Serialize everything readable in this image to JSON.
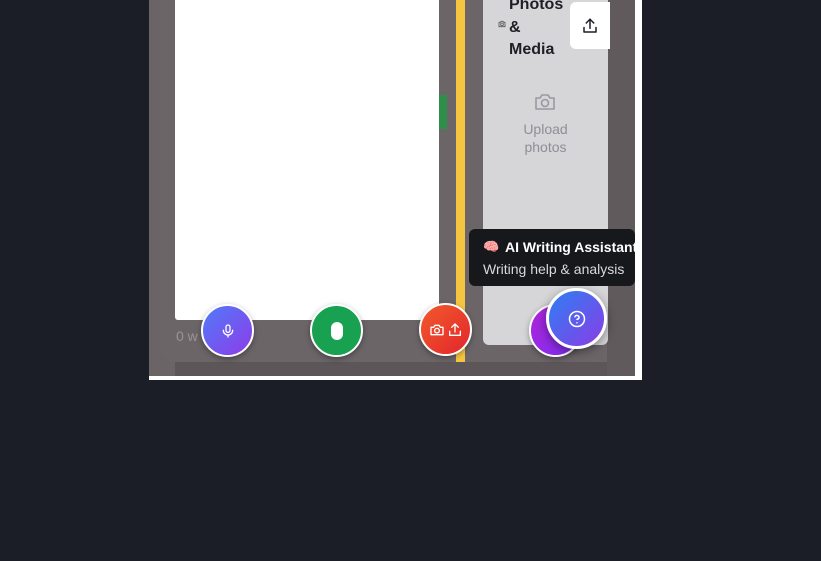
{
  "editor": {
    "word_count_label": "0 w"
  },
  "media_panel": {
    "title": "Photos\n&\nMedia",
    "upload_label": "Upload\nphotos",
    "icons": {
      "header": "camera-icon",
      "upload_button": "upload-icon",
      "placeholder": "camera-icon"
    }
  },
  "tooltip": {
    "emoji": "🧠",
    "title": "AI Writing Assistant",
    "subtitle": "Writing help & analysis"
  },
  "fabs": [
    {
      "name": "voice-input",
      "icon": "microphone-icon",
      "color": "#6b5cf0"
    },
    {
      "name": "record",
      "icon": "pill-icon",
      "color": "#17a150"
    },
    {
      "name": "media",
      "icons": [
        "camera-icon",
        "upload-icon"
      ],
      "color": "#ea4029"
    },
    {
      "name": "ai-writing-assistant",
      "icon": "help-circle-icon",
      "color": "#5b5cf0"
    }
  ],
  "colors": {
    "page_bg": "#1b1e26",
    "divider": "#f5c542",
    "panel_bg": "#d6d5d8",
    "tooltip_bg": "#17181c"
  }
}
